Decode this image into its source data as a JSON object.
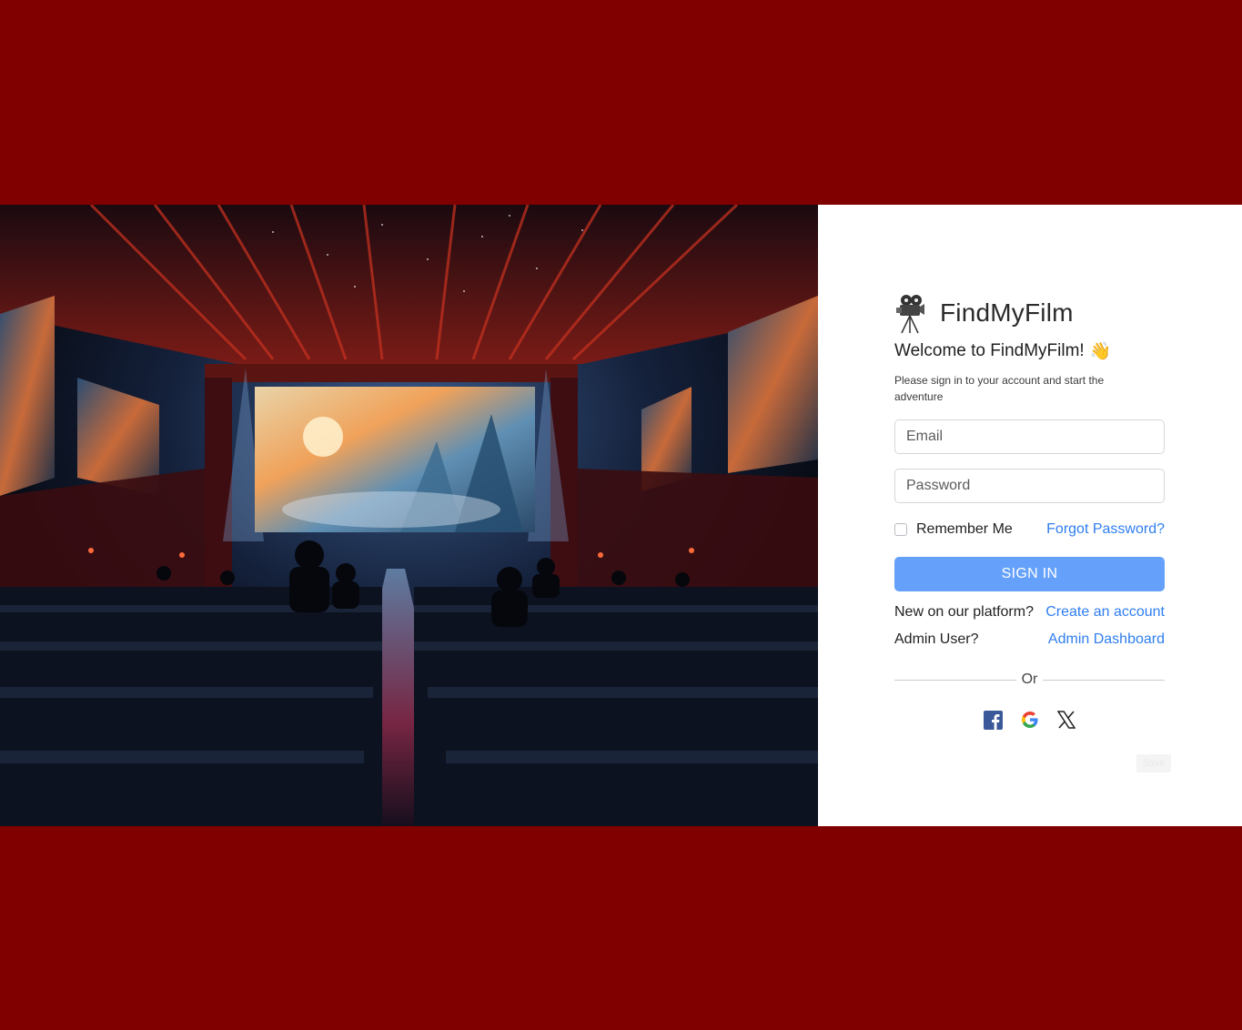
{
  "brand": {
    "name": "FindMyFilm",
    "icon": "film-projector-icon"
  },
  "welcome": {
    "title": "Welcome to FindMyFilm!",
    "emoji": "👋",
    "subtitle": "Please sign in to your account and start the adventure"
  },
  "form": {
    "email_placeholder": "Email",
    "password_placeholder": "Password",
    "remember_label": "Remember Me",
    "forgot_label": "Forgot Password?",
    "signin_label": "SIGN IN"
  },
  "links": {
    "new_prompt": "New on our platform?",
    "create_label": "Create an account",
    "admin_prompt": "Admin User?",
    "admin_label": "Admin Dashboard"
  },
  "divider": {
    "label": "Or"
  },
  "social": [
    "facebook-icon",
    "google-icon",
    "x-icon"
  ],
  "save_label": "Save",
  "colors": {
    "background": "#800000",
    "accent": "#65a1fb",
    "link": "#2f7ef0",
    "facebook": "#3b5998"
  }
}
